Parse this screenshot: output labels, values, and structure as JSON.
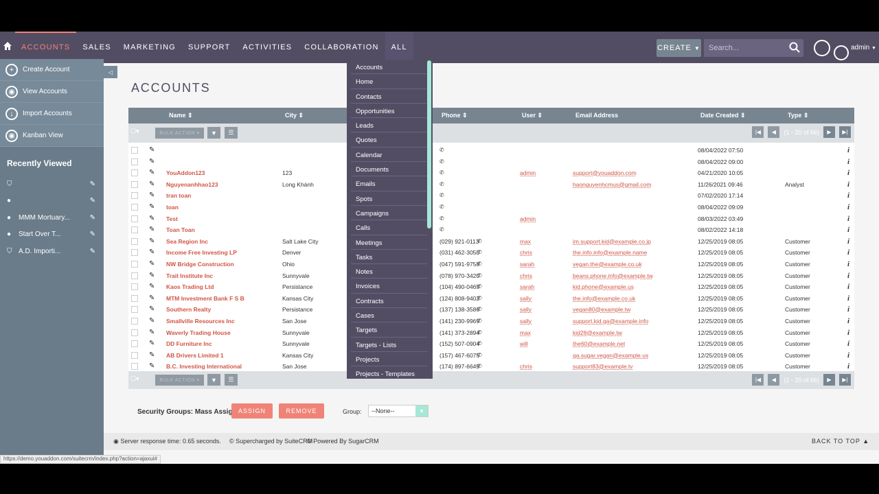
{
  "nav": {
    "items": [
      "ACCOUNTS",
      "SALES",
      "MARKETING",
      "SUPPORT",
      "ACTIVITIES",
      "COLLABORATION",
      "ALL"
    ],
    "create_label": "CREATE",
    "search_placeholder": "Search...",
    "user": "admin"
  },
  "sidebar": {
    "actions": [
      "Create Account",
      "View Accounts",
      "Import Accounts",
      "Kanban View"
    ],
    "recent_title": "Recently Viewed",
    "recent": [
      "",
      "",
      "MMM Mortuary...",
      "Start Over T...",
      "A.D. Importi..."
    ]
  },
  "page_title": "ACCOUNTS",
  "table": {
    "headers": [
      "Name",
      "City",
      "Phone",
      "User",
      "Email Address",
      "Date Created",
      "Type"
    ],
    "bulk_label": "BULK ACTION",
    "pagination": "(1 - 20 of 66)",
    "rows": [
      {
        "name": "",
        "city": "",
        "phone": "",
        "user": "",
        "email": "",
        "date": "08/04/2022 07:50",
        "type": ""
      },
      {
        "name": "",
        "city": "",
        "phone": "",
        "user": "",
        "email": "",
        "date": "08/04/2022 09:00",
        "type": ""
      },
      {
        "name": "YouAddon123",
        "city": "123",
        "phone": "",
        "user": "admin",
        "email": "support@youaddon.com",
        "date": "04/21/2020 10:05",
        "type": ""
      },
      {
        "name": "Nguyenanhhao123",
        "city": "Long Khánh",
        "phone": "",
        "user": "",
        "email": "haonguyenhcmus@gmail.com",
        "date": "11/26/2021 09:46",
        "type": "Analyst"
      },
      {
        "name": "tran toan",
        "city": "",
        "phone": "",
        "user": "",
        "email": "",
        "date": "07/02/2020 17:14",
        "type": ""
      },
      {
        "name": "toan",
        "city": "",
        "phone": "",
        "user": "",
        "email": "",
        "date": "08/04/2022 09:09",
        "type": ""
      },
      {
        "name": "Test",
        "city": "",
        "phone": "",
        "user": "admin",
        "email": "",
        "date": "08/03/2022 03:49",
        "type": ""
      },
      {
        "name": "Toan Toan",
        "city": "",
        "phone": "",
        "user": "",
        "email": "",
        "date": "08/02/2022 14:18",
        "type": ""
      },
      {
        "name": "Sea Region Inc",
        "city": "Salt Lake City",
        "phone": "(029) 921-0113",
        "user": "max",
        "email": "im.support.kid@example.co.jp",
        "date": "12/25/2019 08:05",
        "type": "Customer"
      },
      {
        "name": "Income Free Investing LP",
        "city": "Denver",
        "phone": "(031) 462-3050",
        "user": "chris",
        "email": "the.info.info@example.name",
        "date": "12/25/2019 08:05",
        "type": "Customer"
      },
      {
        "name": "NW Bridge Construction",
        "city": "Ohio",
        "phone": "(047) 591-9758",
        "user": "sarah",
        "email": "vegan.the@example.co.uk",
        "date": "12/25/2019 08:05",
        "type": "Customer"
      },
      {
        "name": "Trait Institute Inc",
        "city": "Sunnyvale",
        "phone": "(078) 970-3420",
        "user": "chris",
        "email": "beans.phone.info@example.tw",
        "date": "12/25/2019 08:05",
        "type": "Customer"
      },
      {
        "name": "Kaos Trading Ltd",
        "city": "Persistance",
        "phone": "(104) 490-0469",
        "user": "sarah",
        "email": "kid.phone@example.us",
        "date": "12/25/2019 08:05",
        "type": "Customer"
      },
      {
        "name": "MTM Investment Bank F S B",
        "city": "Kansas City",
        "phone": "(124) 808-9402",
        "user": "sally",
        "email": "the.info@example.co.uk",
        "date": "12/25/2019 08:05",
        "type": "Customer"
      },
      {
        "name": "Southern Realty",
        "city": "Persistance",
        "phone": "(137) 138-3586",
        "user": "sally",
        "email": "vegan80@example.tw",
        "date": "12/25/2019 08:05",
        "type": "Customer"
      },
      {
        "name": "Smallville Resources Inc",
        "city": "San Jose",
        "phone": "(141) 230-9969",
        "user": "sally",
        "email": "support.kid.qa@example.info",
        "date": "12/25/2019 08:05",
        "type": "Customer"
      },
      {
        "name": "Waverly Trading House",
        "city": "Sunnyvale",
        "phone": "(141) 373-2894",
        "user": "max",
        "email": "kid28@example.tw",
        "date": "12/25/2019 08:05",
        "type": "Customer"
      },
      {
        "name": "DD Furniture Inc",
        "city": "Sunnyvale",
        "phone": "(152) 507-0904",
        "user": "will",
        "email": "the60@example.net",
        "date": "12/25/2019 08:05",
        "type": "Customer"
      },
      {
        "name": "AB Drivers Limited 1",
        "city": "Kansas City",
        "phone": "(157) 467-6075",
        "user": "",
        "email": "qa.sugar.vegan@example.us",
        "date": "12/25/2019 08:05",
        "type": "Customer"
      },
      {
        "name": "B.C. Investing International",
        "city": "San Jose",
        "phone": "(174) 897-6649",
        "user": "chris",
        "email": "support83@example.tv",
        "date": "12/25/2019 08:05",
        "type": "Customer"
      }
    ]
  },
  "dropdown": {
    "items": [
      "Accounts",
      "Home",
      "Contacts",
      "Opportunities",
      "Leads",
      "Quotes",
      "Calendar",
      "Documents",
      "Emails",
      "Spots",
      "Campaigns",
      "Calls",
      "Meetings",
      "Tasks",
      "Notes",
      "Invoices",
      "Contracts",
      "Cases",
      "Targets",
      "Targets - Lists",
      "Projects",
      "Projects - Templates"
    ]
  },
  "mass_assign": {
    "label": "Security Groups: Mass Assign",
    "assign": "ASSIGN",
    "remove": "REMOVE",
    "group_label": "Group:",
    "group_value": "--None--"
  },
  "footer": {
    "response": "Server response time: 0.65 seconds.",
    "suite": "© Supercharged by SuiteCRM",
    "sugar": "© Powered By SugarCRM",
    "back_to_top": "BACK TO TOP"
  },
  "status_url": "https://demo.youaddon.com/suitecrm/index.php?action=ajaxui#"
}
